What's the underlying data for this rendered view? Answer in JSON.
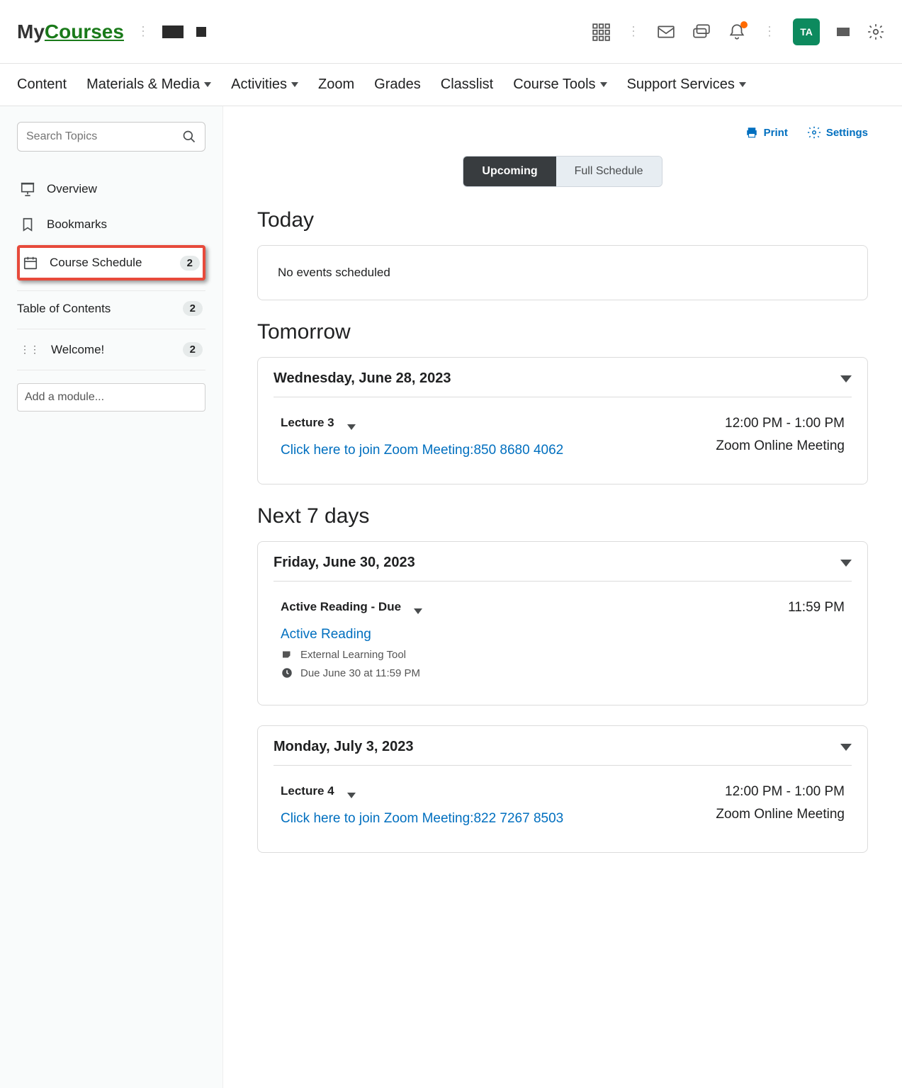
{
  "header": {
    "logo_my": "My",
    "logo_courses": "Courses",
    "avatar_initials": "TA"
  },
  "nav": {
    "content": "Content",
    "materials": "Materials & Media",
    "activities": "Activities",
    "zoom": "Zoom",
    "grades": "Grades",
    "classlist": "Classlist",
    "course_tools": "Course Tools",
    "support": "Support Services"
  },
  "sidebar": {
    "search_placeholder": "Search Topics",
    "overview": "Overview",
    "bookmarks": "Bookmarks",
    "course_schedule": "Course Schedule",
    "course_schedule_badge": "2",
    "toc": "Table of Contents",
    "toc_badge": "2",
    "welcome": "Welcome!",
    "welcome_badge": "2",
    "add_module": "Add a module..."
  },
  "main": {
    "print": "Print",
    "settings": "Settings",
    "tab_upcoming": "Upcoming",
    "tab_full": "Full Schedule",
    "today_title": "Today",
    "today_empty": "No events scheduled",
    "tomorrow_title": "Tomorrow",
    "tomorrow_date": "Wednesday, June 28, 2023",
    "lecture3_title": "Lecture 3",
    "lecture3_time": "12:00 PM - 1:00 PM",
    "lecture3_loc": "Zoom Online Meeting",
    "lecture3_link": "Click here to join Zoom Meeting:850 8680 4062",
    "next7_title": "Next 7 days",
    "friday_date": "Friday, June 30, 2023",
    "active_reading_title": "Active Reading - Due",
    "active_reading_time": "11:59 PM",
    "active_reading_link": "Active Reading",
    "ext_tool": "External Learning Tool",
    "due_text": "Due June 30 at 11:59 PM",
    "monday_date": "Monday, July 3, 2023",
    "lecture4_title": "Lecture 4",
    "lecture4_time": "12:00 PM - 1:00 PM",
    "lecture4_loc": "Zoom Online Meeting",
    "lecture4_link": "Click here to join Zoom Meeting:822 7267 8503"
  }
}
